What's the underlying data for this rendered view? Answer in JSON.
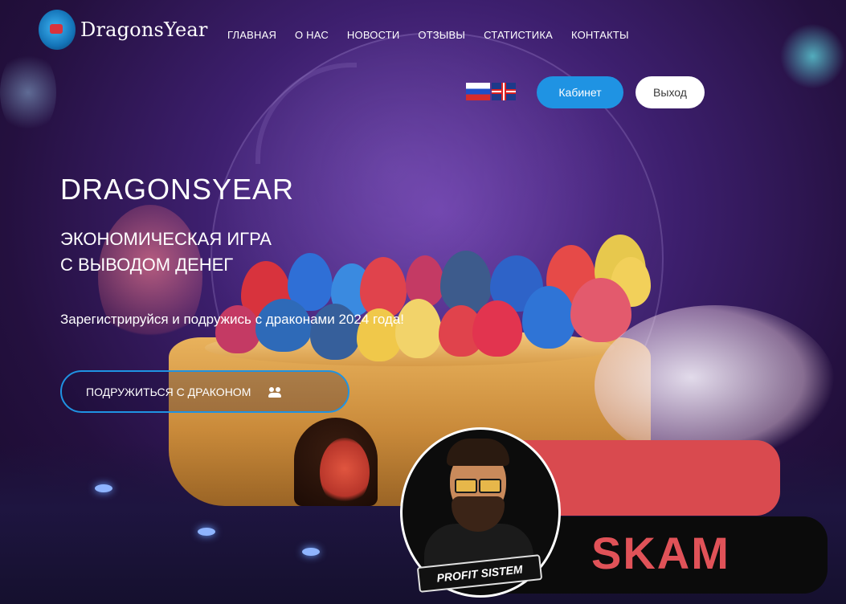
{
  "header": {
    "logo_text": "DragonsYear",
    "nav": [
      "ГЛАВНАЯ",
      "О НАС",
      "НОВОСТИ",
      "ОТЗЫВЫ",
      "СТАТИСТИКА",
      "КОНТАКТЫ"
    ],
    "cabinet_label": "Кабинет",
    "exit_label": "Выход"
  },
  "hero": {
    "title": "DRAGONSYEAR",
    "subtitle_line1": "ЭКОНОМИЧЕСКАЯ ИГРА",
    "subtitle_line2": "С ВЫВОДОМ ДЕНЕГ",
    "text": "Зарегистрируйся и подружись с драконами 2024 года!",
    "cta_label": "ПОДРУЖИТЬСЯ С ДРАКОНОМ"
  },
  "overlay": {
    "stamp_text": "SKAM",
    "avatar_ribbon": "PROFIT SISTEM"
  },
  "icons": {
    "cta_icon": "people-icon",
    "languages": [
      "ru-flag-icon",
      "en-flag-icon"
    ]
  },
  "colors": {
    "accent": "#1f93e3",
    "stamp_red": "#d94a4f"
  }
}
